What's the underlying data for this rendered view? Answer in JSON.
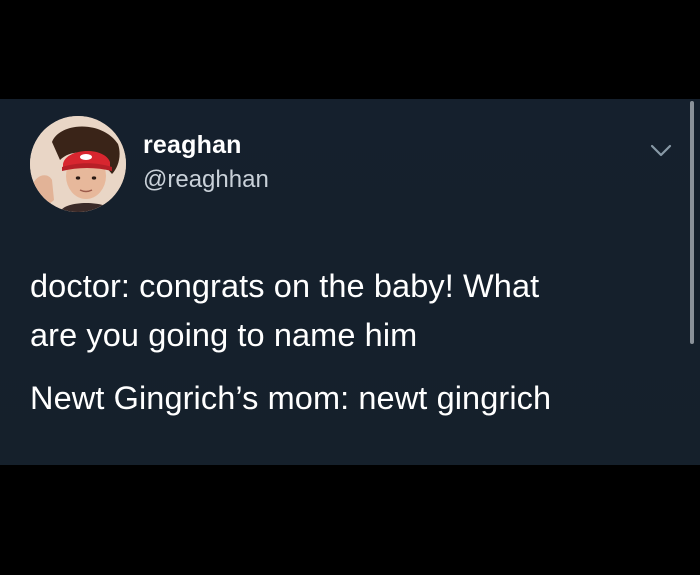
{
  "tweet": {
    "author": {
      "display_name": "reaghan",
      "handle": "@reaghhan",
      "avatar_icon": "profile-photo"
    },
    "menu_icon": "chevron-down-icon",
    "body": {
      "line_1": "doctor: congrats on the baby! What",
      "line_2": "are you going to name him",
      "line_3": "Newt Gingrich’s mom: newt gingrich"
    }
  },
  "colors": {
    "page_background": "#000000",
    "card_background": "#15202b",
    "text_primary": "#ffffff",
    "text_secondary": "#c9d1d9",
    "chevron": "#8899a6",
    "scrollbar": "#8a9199"
  }
}
